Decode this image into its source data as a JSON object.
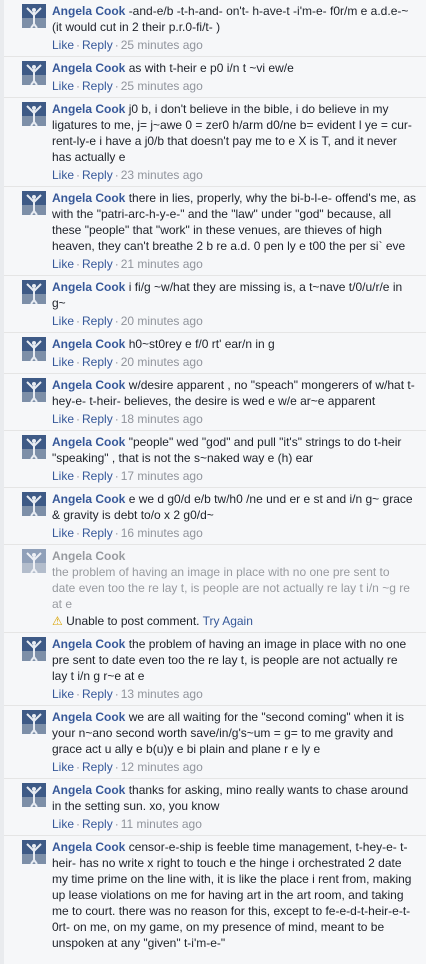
{
  "colors": {
    "author": "#365899",
    "link": "#365899",
    "meta": "#90949c",
    "avatar_bg": "#3e5a86"
  },
  "actions": {
    "like": "Like",
    "reply": "Reply",
    "separator": "·"
  },
  "comments": [
    {
      "author": "Angela Cook",
      "text": "-and-e/b -t-h-and- on't- h-ave-t -i'm-e- f0r/m e a.d.e-~ (it would cut in 2 their p.r.0-fi/t- )",
      "time": "25 minutes ago"
    },
    {
      "author": "Angela Cook",
      "text": "as with t-heir e p0 i/n t ~vi ew/e",
      "time": "25 minutes ago"
    },
    {
      "author": "Angela Cook",
      "text": "j0 b, i don't believe in the bible, i do believe in my ligatures to me, j= j~awe 0 = zer0 h/arm d0/ne b= evident l ye = cur-rent-ly-e i have a j0/b that doesn't pay me to e X is T, and it never has actually e",
      "time": "23 minutes ago"
    },
    {
      "author": "Angela Cook",
      "text": "there in lies, properly, why the bi-b-l-e- offend's me, as with the \"patri-arc-h-y-e-\" and the \"law\" under \"god\" because, all these \"people\" that \"work\" in these venues, are thieves of high heaven, they can't breathe 2 b re a.d. 0 pen ly e t00 the per si` eve",
      "time": "21 minutes ago"
    },
    {
      "author": "Angela Cook",
      "text": "i fi/g ~w/hat they are missing is, a t~nave t/0/u/r/e in g~",
      "time": "20 minutes ago"
    },
    {
      "author": "Angela Cook",
      "text": "h0~st0rey e f/0 rt' ear/n in g",
      "time": "20 minutes ago"
    },
    {
      "author": "Angela Cook",
      "text": "w/desire apparent , no \"speach\" mongerers of w/hat t-hey-e- t-heir- believes, the desire is wed e w/e ar~e apparent",
      "time": "18 minutes ago"
    },
    {
      "author": "Angela Cook",
      "text": "\"people\" wed \"god\" and pull \"it's\" strings to do t-heir \"speaking\" , that is not the s~naked way e (h) ear",
      "time": "17 minutes ago"
    },
    {
      "author": "Angela Cook",
      "text": "e we d g0/d e/b tw/h0 /ne und er e st and i/n g~ grace & gravity is debt to/o x 2 g0/d~",
      "time": "16 minutes ago"
    }
  ],
  "failed_comment": {
    "author": "Angela Cook",
    "text": "the problem of having an image in place with no one pre sent to date even too the re lay t, is people are not actually re lay t i/n ~g re at e",
    "error": "Unable to post comment.",
    "retry": "Try Again"
  },
  "comments_after": [
    {
      "author": "Angela Cook",
      "text": "the problem of having an image in place with no one pre sent to date even too the re lay t, is people are not actually re lay t i/n g r~e at e",
      "time": "13 minutes ago"
    },
    {
      "author": "Angela Cook",
      "text": "we are all waiting for the \"second coming\" when it is your n~ano second worth save/in/g's~um = g= to me gravity and grace act u ally e b(u)y e bi plain and plane r e ly e",
      "time": "12 minutes ago"
    },
    {
      "author": "Angela Cook",
      "text": "thanks for asking, mino really wants to chase around in the setting sun. xo, you know",
      "time": "11 minutes ago"
    },
    {
      "author": "Angela Cook",
      "text": "censor-e-ship is feeble time management, t-hey-e- t-heir- has no write x right to touch e the hinge i orchestrated 2 date my time prime on the line with, it is like the place i rent from, making up lease violations on me for having art in the art room, and taking me to court. there was no reason for this, except to fe-e-d-t-heir-e-t-0rt- on me, on my game, on my presence of mind, meant to be unspoken at any \"given\" t-i'm-e-\""
    }
  ]
}
